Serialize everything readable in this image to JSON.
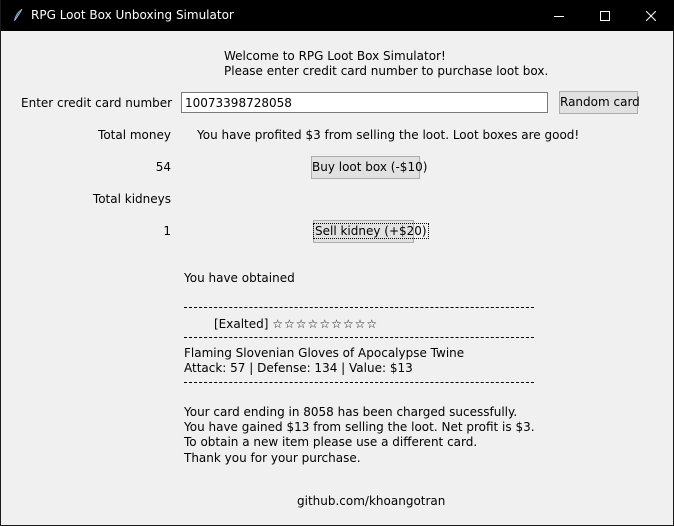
{
  "window": {
    "title": "RPG Loot Box Unboxing Simulator",
    "controls": {
      "minimize": "minimize-icon",
      "maximize": "maximize-icon",
      "close": "close-icon"
    }
  },
  "welcome": {
    "line1": "Welcome to RPG Loot Box Simulator!",
    "line2": "Please enter credit card number to purchase loot box."
  },
  "card": {
    "label": "Enter credit card number",
    "value": "10073398728058",
    "random_button": "Random card"
  },
  "money": {
    "label": "Total money",
    "value": "54",
    "status": "You have profited $3 from selling the loot. Loot boxes are good!",
    "buy_button": "Buy loot box (-$10)"
  },
  "kidneys": {
    "label": "Total kidneys",
    "value": "1",
    "sell_button": "Sell kidney (+$20)"
  },
  "loot": {
    "heading": "You have obtained",
    "rarity": "[Exalted]",
    "stars": "☆☆☆☆☆☆☆☆☆",
    "item_name": "Flaming Slovenian Gloves of Apocalypse Twine",
    "item_stats": "Attack: 57 | Defense: 134 | Value: $13"
  },
  "receipt": {
    "line1": "Your card ending in 8058 has been charged sucessfully.",
    "line2": "You have gained $13 from selling the loot. Net profit is $3.",
    "line3": "To obtain a new item please use a different card.",
    "line4": "Thank you for your purchase."
  },
  "footer": {
    "link": "github.com/khoangotran"
  }
}
